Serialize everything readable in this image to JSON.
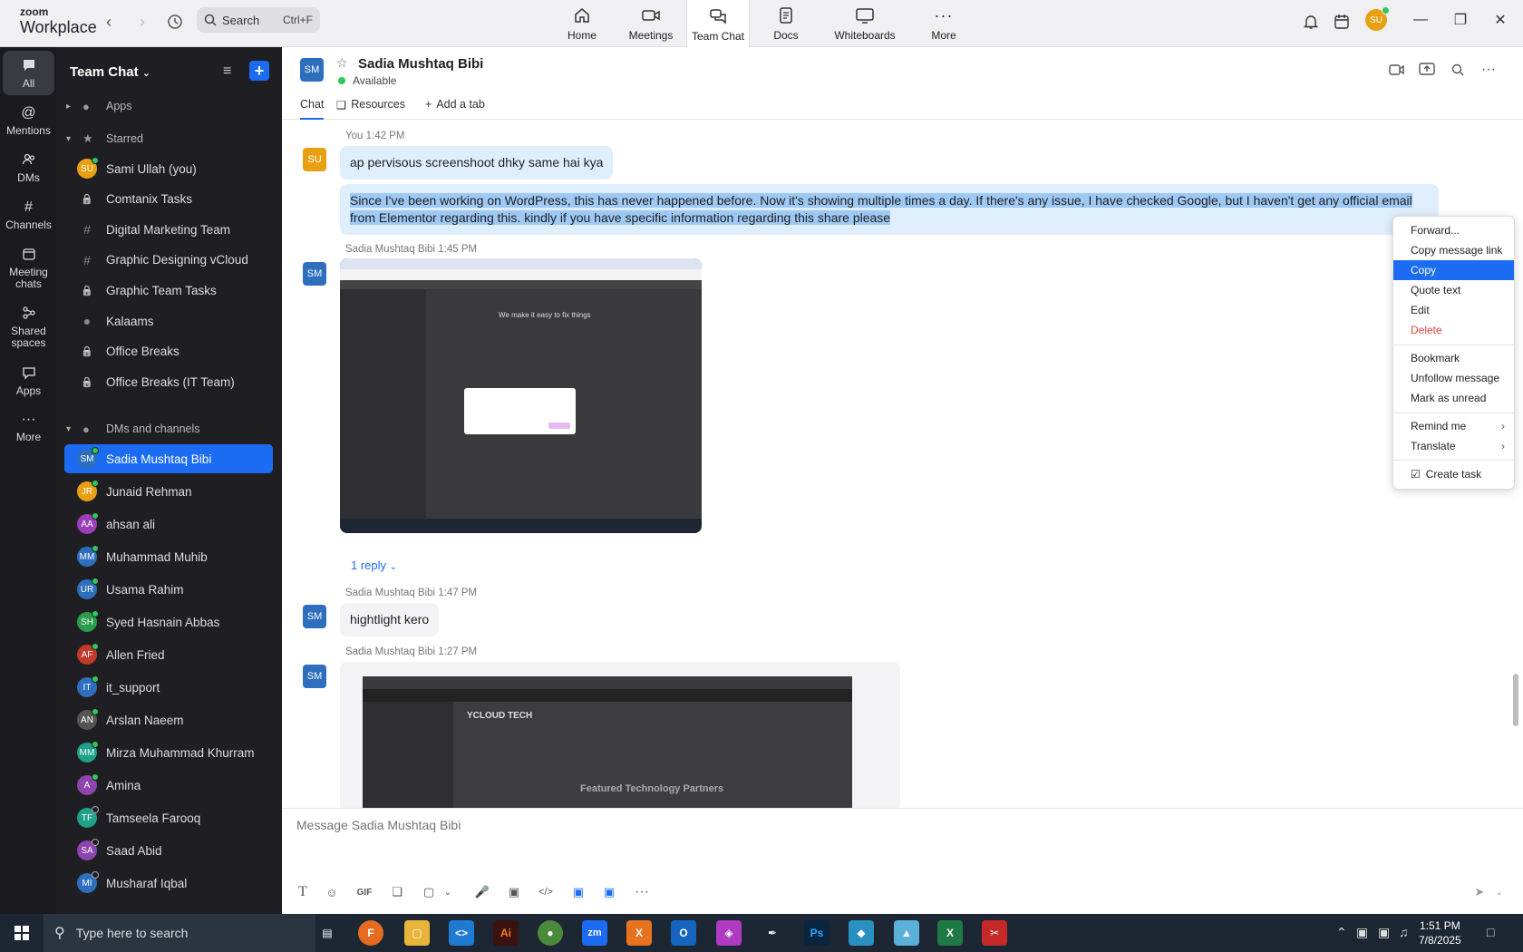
{
  "app": {
    "brand_line1": "zoom",
    "brand_line2": "Workplace"
  },
  "search": {
    "label": "Search",
    "shortcut": "Ctrl+F"
  },
  "nav_tabs": [
    {
      "label": "Home",
      "icon": "home-icon"
    },
    {
      "label": "Meetings",
      "icon": "video-icon"
    },
    {
      "label": "Team Chat",
      "icon": "chat-icon"
    },
    {
      "label": "Docs",
      "icon": "doc-icon"
    },
    {
      "label": "Whiteboards",
      "icon": "whiteboard-icon"
    },
    {
      "label": "More",
      "icon": "more-icon"
    }
  ],
  "user_avatar": "SU",
  "rail": [
    {
      "label": "All"
    },
    {
      "label": "Mentions"
    },
    {
      "label": "DMs"
    },
    {
      "label": "Channels"
    },
    {
      "label": "Meeting\nchats"
    },
    {
      "label": "Shared\nspaces"
    },
    {
      "label": "Apps"
    },
    {
      "label": "More"
    }
  ],
  "sidebar": {
    "title": "Team Chat",
    "sections": {
      "apps": "Apps",
      "starred": "Starred",
      "dms": "DMs and channels"
    },
    "starred": [
      {
        "label": "Sami Ullah (you)",
        "initials": "SU",
        "color": "#e8a013",
        "kind": "avatar"
      },
      {
        "label": "Comtanix Tasks",
        "kind": "lock"
      },
      {
        "label": "Digital Marketing Team",
        "kind": "hash"
      },
      {
        "label": "Graphic Designing vCloud",
        "kind": "hash"
      },
      {
        "label": "Graphic Team Tasks",
        "kind": "lock"
      },
      {
        "label": "Kalaams",
        "kind": "group"
      },
      {
        "label": "Office Breaks",
        "kind": "lock"
      },
      {
        "label": "Office Breaks (IT Team)",
        "kind": "lock"
      }
    ],
    "dms": [
      {
        "label": "Sadia Mushtaq Bibi",
        "initials": "SM",
        "color": "#2e6fbd",
        "selected": true
      },
      {
        "label": "Junaid Rehman",
        "initials": "JR",
        "color": "#e8a013"
      },
      {
        "label": "ahsan ali",
        "initials": "AA",
        "color": "#9b3fb8"
      },
      {
        "label": "Muhammad Muhib",
        "initials": "MM",
        "color": "#2e6fbd"
      },
      {
        "label": "Usama Rahim",
        "initials": "UR",
        "color": "#2e6fbd"
      },
      {
        "label": "Syed Hasnain Abbas",
        "initials": "SH",
        "color": "#2a9d4b"
      },
      {
        "label": "Allen Fried",
        "initials": "AF",
        "color": "#c0392b"
      },
      {
        "label": "it_support",
        "initials": "IT",
        "color": "#2e6fbd"
      },
      {
        "label": "Arslan Naeem",
        "initials": "AN",
        "color": "#555"
      },
      {
        "label": "Mirza Muhammad Khurram",
        "initials": "MM",
        "color": "#1fa08a"
      },
      {
        "label": "Amina",
        "initials": "A",
        "color": "#8e44ad"
      },
      {
        "label": "Tamseela Farooq",
        "initials": "TF",
        "color": "#1fa08a"
      },
      {
        "label": "Saad Abid",
        "initials": "SA",
        "color": "#8e44ad"
      },
      {
        "label": "Musharaf Iqbal",
        "initials": "MI",
        "color": "#2e6fbd"
      }
    ]
  },
  "chat": {
    "name": "Sadia Mushtaq Bibi",
    "initials": "SM",
    "status": "Available",
    "tabs": [
      "Chat",
      "Resources",
      "Add a tab"
    ],
    "messages": {
      "m1_meta": "You 1:42 PM",
      "m1_text": "ap pervisous screenshoot dhky same hai kya",
      "m2_text": "Since I've been working on WordPress, this has never happened before. Now it's showing multiple times a day. If there's any issue, I have checked Google, but I haven't get any official email from Elementor regarding this. kindly if you have specific information regarding this share please",
      "m3_meta": "Sadia Mushtaq Bibi 1:45 PM",
      "reply": "1 reply",
      "m4_meta": "Sadia Mushtaq Bibi 1:47 PM",
      "m4_text": "hightlight kero",
      "m5_meta": "Sadia Mushtaq Bibi 1:27 PM",
      "shot1_heading": "We make it easy to fix things",
      "shot2_brand": "YCLOUD TECH",
      "shot2_heading": "Featured Technology Partners"
    },
    "composer_placeholder": "Message Sadia Mushtaq Bibi"
  },
  "context_menu": {
    "items": [
      "Forward...",
      "Copy message link",
      "Copy",
      "Quote text",
      "Edit",
      "Delete",
      "Bookmark",
      "Unfollow message",
      "Mark as unread",
      "Remind me",
      "Translate",
      "Create task"
    ]
  },
  "taskbar": {
    "search_placeholder": "Type here to search",
    "time": "1:51 PM",
    "date": "7/8/2025"
  }
}
